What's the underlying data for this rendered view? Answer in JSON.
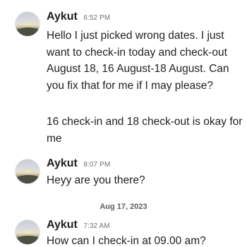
{
  "messages": [
    {
      "sender": "Aykut",
      "time": "6:52 PM",
      "paragraphs": [
        "Hello I just picked wrong dates. I just want to check-in today and check-out August 18, 16 August-18 August. Can you fix that for me if I may please?",
        "16 check-in and 18 check-out is okay for me"
      ]
    },
    {
      "sender": "Aykut",
      "time": "8:07 PM",
      "paragraphs": [
        "Heyy are you there?"
      ]
    },
    {
      "sender": "Aykut",
      "time": "7:32 AM",
      "paragraphs": [
        "How can I check-in at 09.00 am?"
      ]
    }
  ],
  "date_separator": "Aug 17, 2023"
}
